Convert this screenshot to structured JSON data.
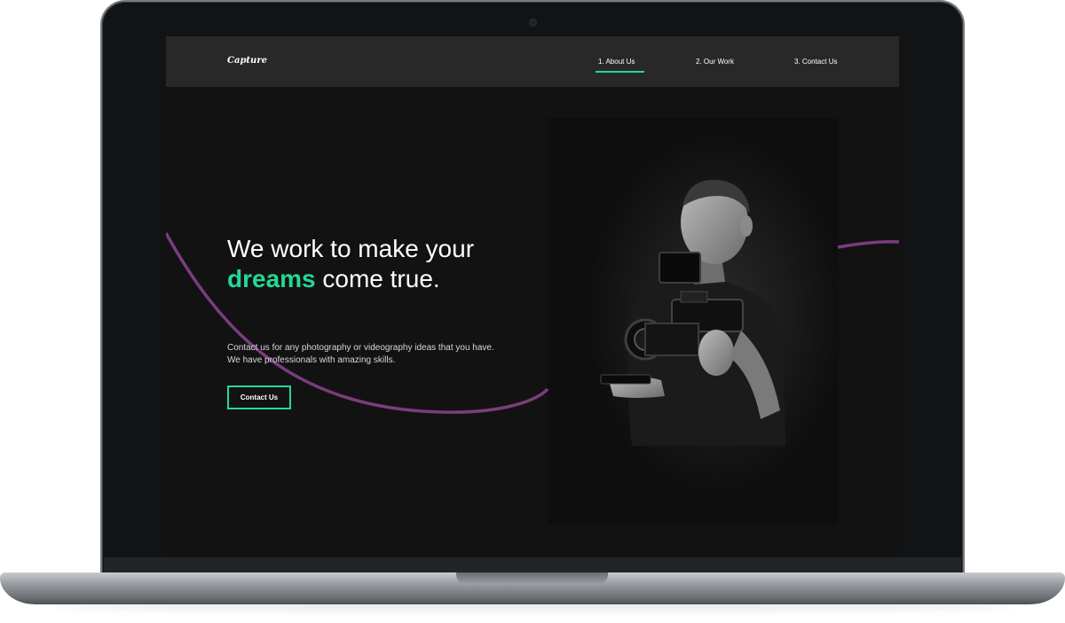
{
  "nav": {
    "logo": "Capture",
    "links": [
      {
        "label": "1. About Us",
        "active": true
      },
      {
        "label": "2. Our Work",
        "active": false
      },
      {
        "label": "3. Contact Us",
        "active": false
      }
    ]
  },
  "hero": {
    "headline_pre": "We work to make your ",
    "headline_highlight": "dreams",
    "headline_post": " come true.",
    "description_line1": "Contact us for any photography or videography ideas that you have.",
    "description_line2": "We have professionals with amazing skills.",
    "cta_label": "Contact Us",
    "photo_icon": "photographer-with-camera-image"
  },
  "colors": {
    "accent": "#23d997",
    "curve": "#7a3d7e",
    "background": "#121212",
    "nav_background": "#282828"
  }
}
